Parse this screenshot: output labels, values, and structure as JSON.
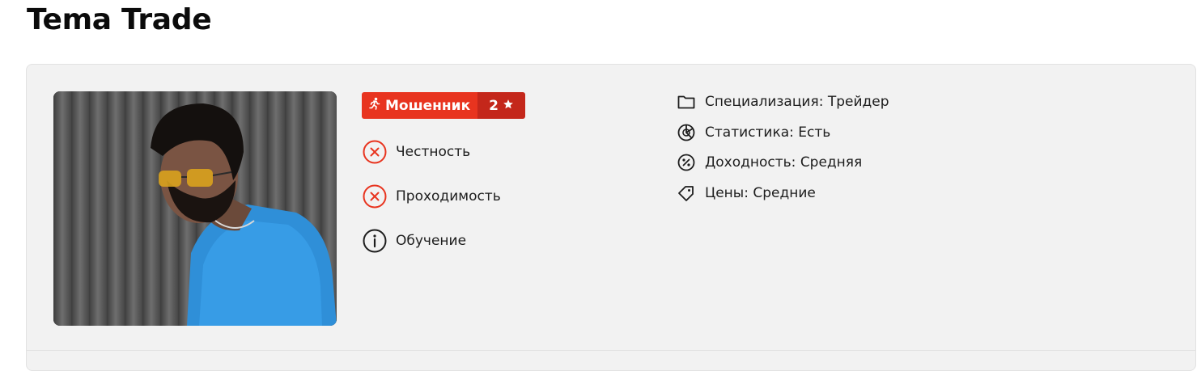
{
  "page": {
    "title": "Tema Trade"
  },
  "badge": {
    "status_label": "Мошенник",
    "rank": "2",
    "status_icon": "fraud-runner-icon",
    "rank_icon": "star-icon",
    "colors": {
      "main": "#e8341f",
      "rank": "#c4271b"
    }
  },
  "criteria": [
    {
      "label": "Честность",
      "icon": "x-circle-icon",
      "state": "failed",
      "color": "#e8341f"
    },
    {
      "label": "Проходимость",
      "icon": "x-circle-icon",
      "state": "failed",
      "color": "#e8341f"
    },
    {
      "label": "Обучение",
      "icon": "info-circle-icon",
      "state": "neutral",
      "color": "#1d1d1d"
    }
  ],
  "info": [
    {
      "label": "Специализация: Трейдер",
      "icon": "folder-icon"
    },
    {
      "label": "Статистика: Есть",
      "icon": "chart-pie-icon"
    },
    {
      "label": "Доходность: Средняя",
      "icon": "percent-badge-icon"
    },
    {
      "label": "Цены: Средние",
      "icon": "price-tag-icon"
    }
  ],
  "photo": {
    "alt": "profile-photo"
  }
}
